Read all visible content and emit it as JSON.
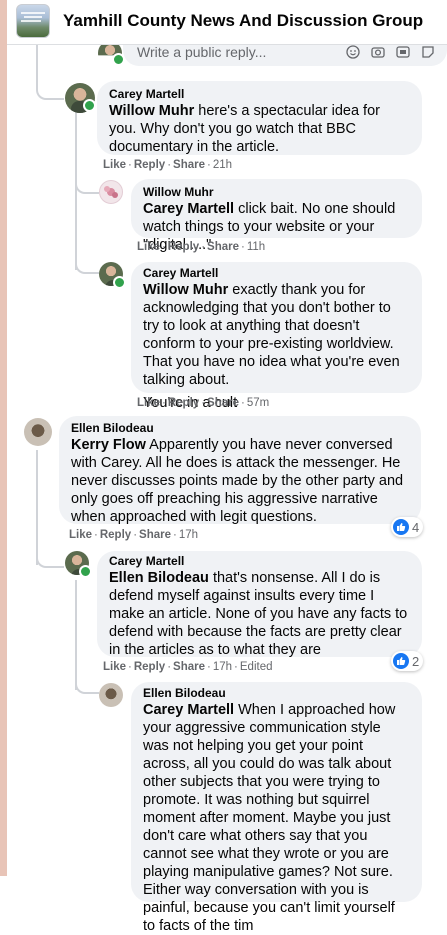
{
  "header": {
    "title": "Yamhill County News And Discussion Group"
  },
  "reply_box": {
    "placeholder": "Write a public reply...",
    "icons": [
      "emoji-icon",
      "camera-icon",
      "gif-icon",
      "sticker-icon"
    ]
  },
  "comments": [
    {
      "author": "Carey Martell",
      "mention": "Willow Muhr",
      "text": " here's a spectacular idea for you. Why don't you go watch that BBC documentary in the article.",
      "actions": {
        "like": "Like",
        "reply": "Reply",
        "share": "Share",
        "time": "21h"
      }
    },
    {
      "author": "Willow Muhr",
      "mention": "Carey Martell",
      "text": " click bait. No one should watch things to your website or your \"digital.....\"",
      "actions": {
        "like": "Like",
        "reply": "Reply",
        "share": "Share",
        "time": "11h"
      }
    },
    {
      "author": "Carey Martell",
      "mention": "Willow Muhr",
      "text": " exactly thank you for acknowledging that you don't bother to try to look at anything that doesn't conform to your pre-existing worldview. That you have no idea what you're even talking about.",
      "text2": "You're in a cult",
      "actions": {
        "like": "Like",
        "reply": "Reply",
        "share": "Share",
        "time": "57m"
      }
    },
    {
      "author": "Ellen Bilodeau",
      "mention": "Kerry Flow",
      "text": " Apparently you have never conversed with Carey. All he does is attack the messenger. He never discusses points made by the other party and only goes off preaching his aggressive narrative when approached with legit questions.",
      "actions": {
        "like": "Like",
        "reply": "Reply",
        "share": "Share",
        "time": "17h"
      },
      "reactions": "4"
    },
    {
      "author": "Carey Martell",
      "mention": "Ellen Bilodeau",
      "text": " that's nonsense. All I do is defend myself against insults every time I make an article. None of you have any facts to defend with because the facts are pretty clear in the articles as to what they are",
      "actions": {
        "like": "Like",
        "reply": "Reply",
        "share": "Share",
        "time": "17h",
        "edited": "Edited"
      },
      "reactions": "2"
    },
    {
      "author": "Ellen Bilodeau",
      "mention": "Carey Martell",
      "text": " When I approached how your aggressive communication style was not helping you get your point across, all you could do was talk about other subjects that you were trying to promote. It was nothing but squirrel moment after moment. Maybe you just don't care what others say that you cannot see what they wrote or you are playing manipulative games? Not sure. Either way conversation with you is painful, because you can't limit yourself to facts of the tim"
    }
  ]
}
